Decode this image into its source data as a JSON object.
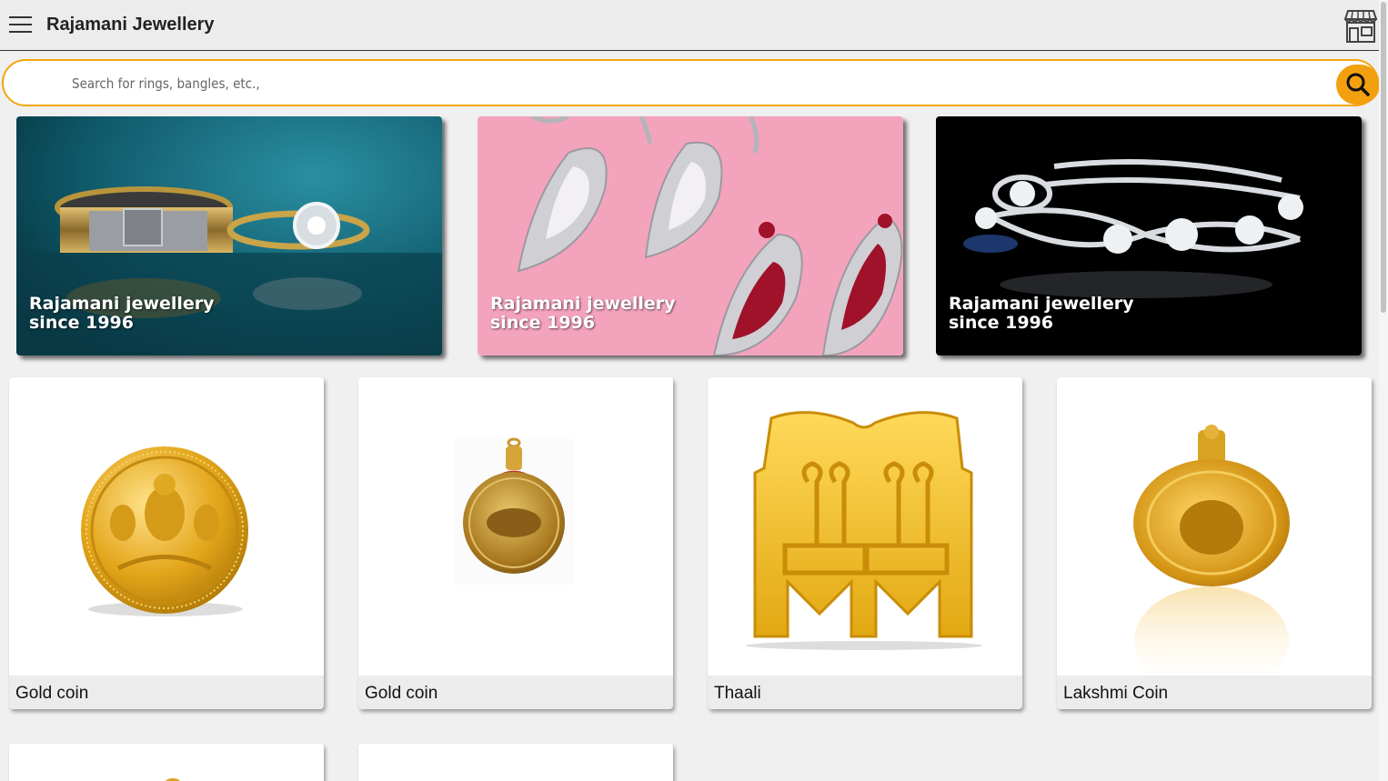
{
  "header": {
    "title": "Rajamani Jewellery",
    "menu_icon": "hamburger-icon",
    "store_icon": "storefront-icon"
  },
  "search": {
    "placeholder": "Search for rings, bangles, etc.,",
    "value": "",
    "button_icon": "search-icon",
    "accent": "#f2a00e"
  },
  "banners": [
    {
      "line1": "Rajamani jewellery",
      "line2": "since 1996"
    },
    {
      "line1": "Rajamani jewellery",
      "line2": "since 1996"
    },
    {
      "line1": "Rajamani jewellery",
      "line2": "since 1996"
    }
  ],
  "products": [
    {
      "name": "Gold coin"
    },
    {
      "name": "Gold coin"
    },
    {
      "name": "Thaali"
    },
    {
      "name": "Lakshmi Coin"
    }
  ]
}
